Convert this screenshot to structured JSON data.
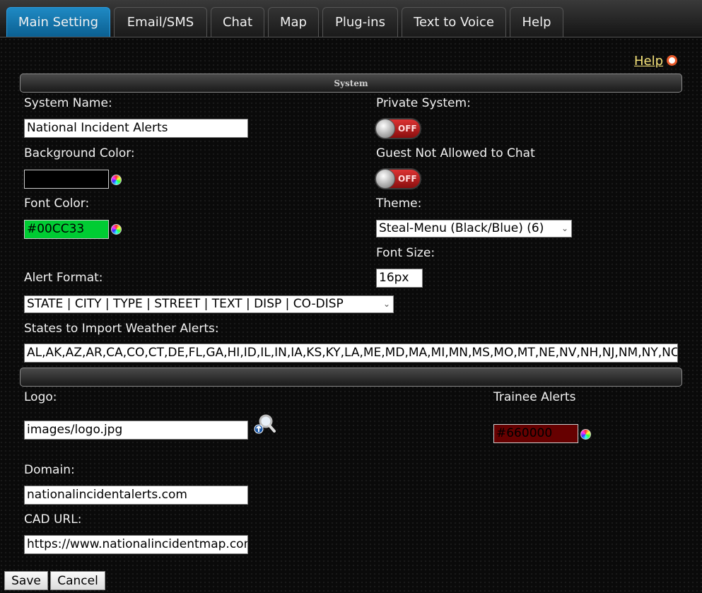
{
  "tabs": [
    {
      "label": "Main Setting",
      "active": true
    },
    {
      "label": "Email/SMS"
    },
    {
      "label": "Chat"
    },
    {
      "label": "Map"
    },
    {
      "label": "Plug-ins"
    },
    {
      "label": "Text to Voice"
    },
    {
      "label": "Help"
    }
  ],
  "help_link": "Help",
  "sections": {
    "system_title": "System",
    "second_title": ""
  },
  "fields": {
    "system_name": {
      "label": "System Name:",
      "value": "National Incident Alerts"
    },
    "private_system": {
      "label": "Private System:",
      "state": "OFF"
    },
    "background_color": {
      "label": "Background Color:",
      "value": "",
      "color": "#000000"
    },
    "guest_chat": {
      "label": "Guest Not Allowed to Chat",
      "state": "OFF"
    },
    "font_color": {
      "label": "Font Color:",
      "value": "#00CC33",
      "color": "#00CC33"
    },
    "theme": {
      "label": "Theme:",
      "value": "Steal-Menu (Black/Blue) (6)"
    },
    "font_size": {
      "label": "Font Size:",
      "value": "16px"
    },
    "alert_format": {
      "label": "Alert Format:",
      "value": "STATE | CITY | TYPE | STREET | TEXT | DISP | CO-DISP"
    },
    "weather_states": {
      "label": "States to Import Weather Alerts:",
      "value": "AL,AK,AZ,AR,CA,CO,CT,DE,FL,GA,HI,ID,IL,IN,IA,KS,KY,LA,ME,MD,MA,MI,MN,MS,MO,MT,NE,NV,NH,NJ,NM,NY,NC,ND,OH,OK,OR,PA,RI,SC,SD,TN,TX,UT,VT,VA,WA,WV,WI,WY"
    },
    "logo": {
      "label": "Logo:",
      "value": "images/logo.jpg"
    },
    "trainee_alerts": {
      "label": "Trainee Alerts",
      "value": "#660000",
      "color": "#660000"
    },
    "domain": {
      "label": "Domain:",
      "value": "nationalincidentalerts.com"
    },
    "cad_url": {
      "label": "CAD URL:",
      "value": "https://www.nationalincidentmap.com"
    }
  },
  "buttons": {
    "save": "Save",
    "cancel": "Cancel"
  }
}
